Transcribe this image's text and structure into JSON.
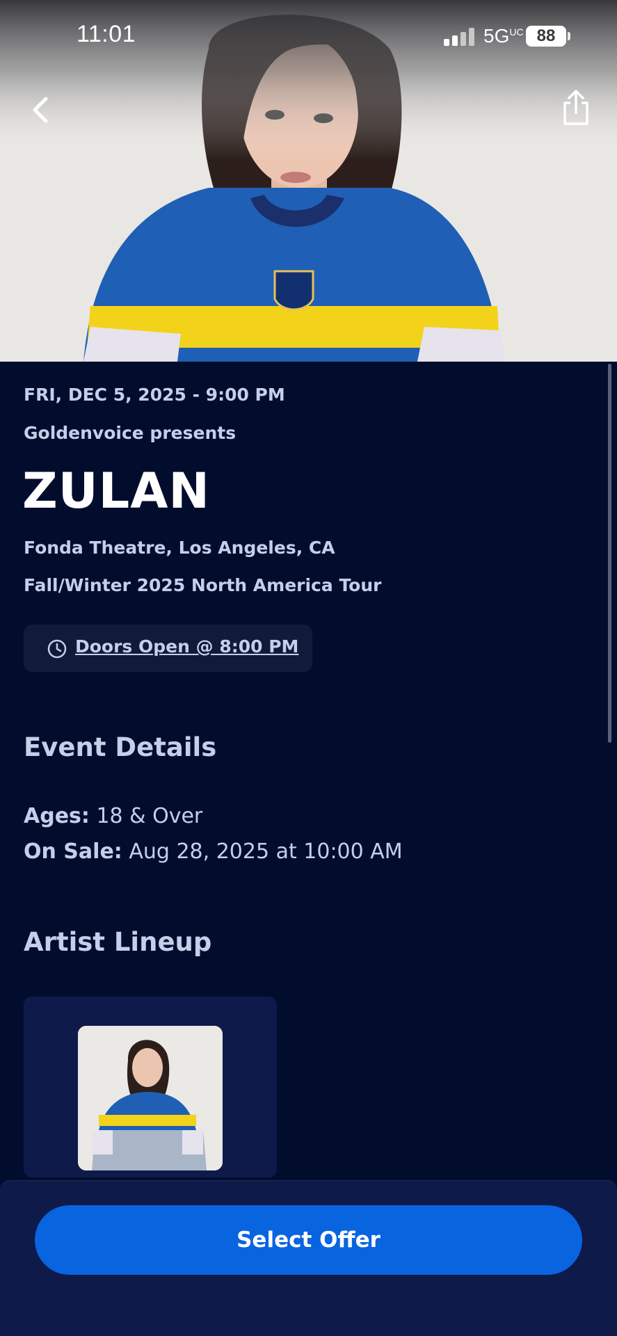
{
  "status": {
    "time": "11:01",
    "network": "5G",
    "network_suffix": "UC",
    "battery": "88"
  },
  "event": {
    "date": "FRI, DEC 5, 2025 - 9:00 PM",
    "presenter": "Goldenvoice presents",
    "artist": "ZULAN",
    "venue": "Fonda Theatre, Los Angeles, CA",
    "tour": "Fall/Winter 2025 North America Tour",
    "doors": "Doors Open @ 8:00 PM"
  },
  "details": {
    "heading": "Event Details",
    "ages_label": "Ages:",
    "ages_value": "18 & Over",
    "onsale_label": "On Sale:",
    "onsale_value": "Aug 28, 2025 at 10:00 AM"
  },
  "lineup": {
    "heading": "Artist Lineup"
  },
  "cta": {
    "label": "Select Offer"
  },
  "colors": {
    "background": "#020d2e",
    "accent": "#0964e0",
    "card": "#0d1a4a"
  },
  "icons": {
    "back": "chevron-left-icon",
    "share": "share-icon",
    "clock": "clock-icon"
  }
}
